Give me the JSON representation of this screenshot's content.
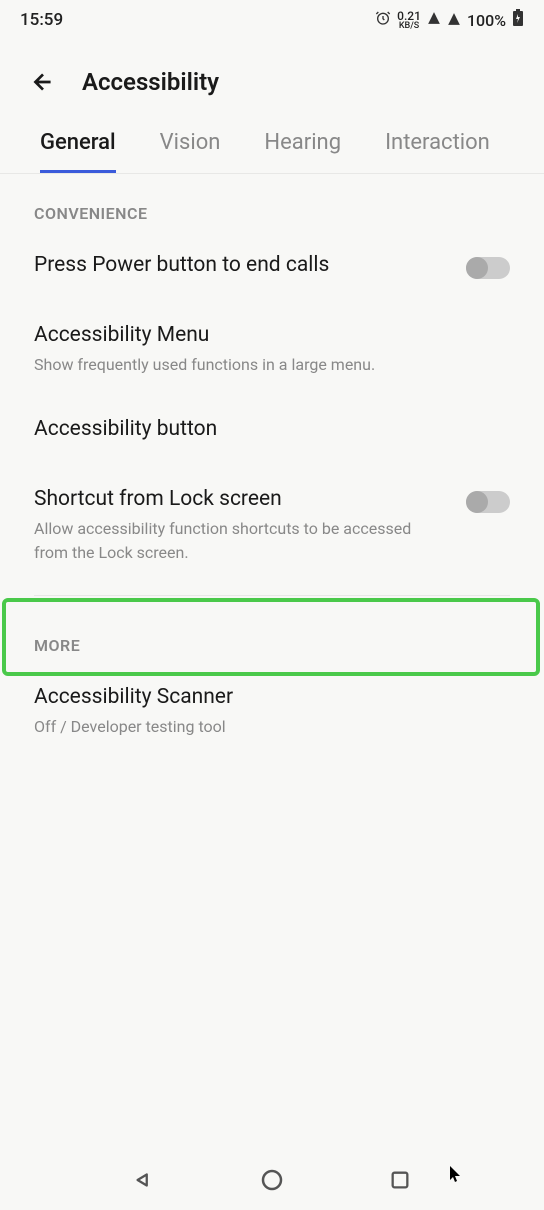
{
  "status": {
    "time": "15:59",
    "kbs_num": "0.21",
    "kbs_label": "KB/S",
    "battery": "100%"
  },
  "header": {
    "title": "Accessibility"
  },
  "tabs": [
    {
      "label": "General",
      "active": true
    },
    {
      "label": "Vision",
      "active": false
    },
    {
      "label": "Hearing",
      "active": false
    },
    {
      "label": "Interaction",
      "active": false
    }
  ],
  "sections": {
    "convenience": {
      "header": "CONVENIENCE",
      "items": [
        {
          "title": "Press Power button to end calls",
          "subtitle": "",
          "toggle": true
        },
        {
          "title": "Accessibility Menu",
          "subtitle": "Show frequently used functions in a large menu.",
          "toggle": false
        },
        {
          "title": "Accessibility button",
          "subtitle": "",
          "toggle": false
        },
        {
          "title": "Shortcut from Lock screen",
          "subtitle": "Allow accessibility function shortcuts to be accessed from the Lock screen.",
          "toggle": true
        }
      ]
    },
    "more": {
      "header": "MORE",
      "items": [
        {
          "title": "Accessibility Scanner",
          "subtitle": "Off / Developer testing tool",
          "toggle": false
        }
      ]
    }
  }
}
